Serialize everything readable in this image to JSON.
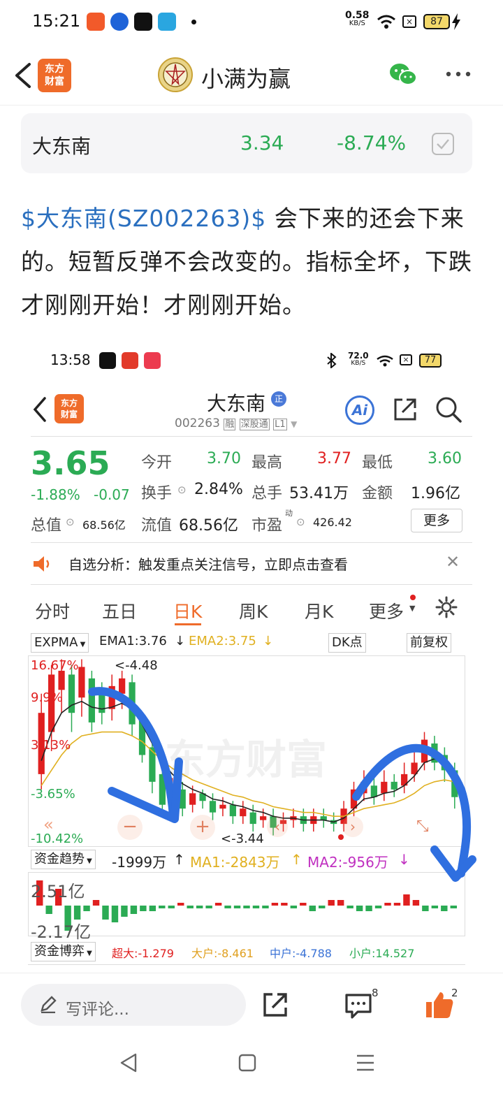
{
  "status_bar": {
    "time": "15:21",
    "net_speed": "0.58",
    "net_unit": "KB/S",
    "battery": "87"
  },
  "header": {
    "logo": [
      "东方",
      "财富"
    ],
    "title": "小满为赢"
  },
  "stock_card": {
    "name": "大东南",
    "price": "3.34",
    "change_pct": "-8.74%"
  },
  "post": {
    "tag": "$大东南(SZ002263)$",
    "text": " 会下来的还会下来的。短暂反弹不会改变的。指标全坏，下跌才刚刚开始！才刚刚开始。"
  },
  "embedded": {
    "status": {
      "time": "13:58",
      "net_speed": "72.0",
      "net_unit": "KB/S",
      "battery": "77"
    },
    "logo": [
      "东方",
      "财富"
    ],
    "stock_name": "大东南",
    "badge": "正",
    "code_line": "002263",
    "code_tags": [
      "融",
      "深股通",
      "L1"
    ],
    "ai_label": "Ai",
    "quote": {
      "price": "3.65",
      "change_pct": "-1.88%",
      "change": "-0.07",
      "open_label": "今开",
      "open": "3.70",
      "high_label": "最高",
      "high": "3.77",
      "low_label": "最低",
      "low": "3.60",
      "turnover_label": "换手",
      "turnover": "2.84%",
      "volume_label": "总手",
      "volume": "53.41万",
      "amount_label": "金额",
      "amount": "1.96亿",
      "mcap_label": "总值",
      "mcap": "68.56亿",
      "float_label": "流值",
      "float": "68.56亿",
      "pe_label": "市盈",
      "pe_sup": "动",
      "pe": "426.42",
      "more": "更多"
    },
    "notice": "自选分析：触发重点关注信号，立即点击查看",
    "tabs": [
      "分时",
      "五日",
      "日K",
      "周K",
      "月K",
      "更多"
    ],
    "active_tab": "日K",
    "indicator": {
      "name": "EXPMA",
      "ema1": "EMA1:3.76",
      "ema2": "EMA2:3.75",
      "dk": "DK点",
      "fq": "前复权"
    },
    "chart_labels": {
      "y1": "16.67%",
      "y2": "9.9%",
      "y3": "3.13%",
      "y4": "-3.65%",
      "y5": "-10.42%",
      "hi": "<-4.48",
      "lo": "<-3.44"
    },
    "watermark": "东方财富",
    "fund": {
      "name": "资金趋势",
      "val": "-1999万",
      "ma1": "MA1:-2843万",
      "ma2": "MA2:-956万",
      "top": "2.51亿",
      "bottom": "-2.17亿"
    },
    "game": {
      "name": "资金博弈",
      "super": "超大:-1.279",
      "big": "大户:-8.461",
      "mid": "中户:-4.788",
      "small": "小户:14.527"
    }
  },
  "bottom": {
    "comment_placeholder": "写评论...",
    "comment_count": "8",
    "like_count": "2"
  },
  "colors": {
    "up": "#e02020",
    "down": "#2bab54",
    "accent": "#ef6b2a",
    "link": "#2a6fbf",
    "annotation": "#2f6fe0"
  }
}
